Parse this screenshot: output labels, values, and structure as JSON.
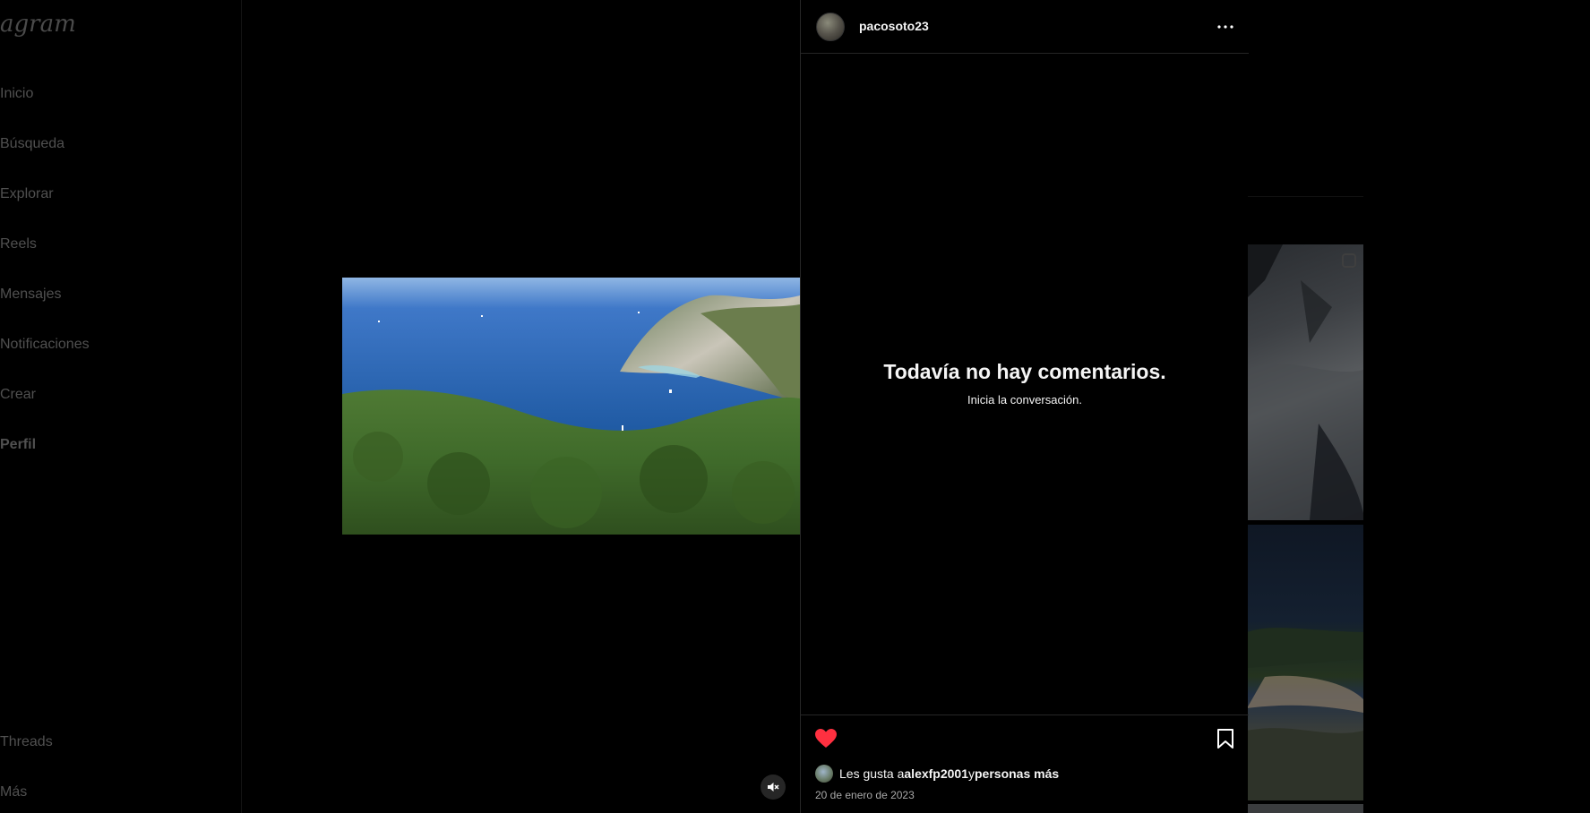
{
  "sidebar": {
    "logo": "agram",
    "items": [
      {
        "label": "Inicio"
      },
      {
        "label": "Búsqueda"
      },
      {
        "label": "Explorar"
      },
      {
        "label": "Reels"
      },
      {
        "label": "Mensajes"
      },
      {
        "label": "Notificaciones"
      },
      {
        "label": "Crear"
      },
      {
        "label": "Perfil"
      }
    ],
    "bottom": [
      {
        "label": "Threads"
      },
      {
        "label": "Más"
      }
    ]
  },
  "post": {
    "username": "pacosoto23",
    "more_icon": "more-horizontal-icon",
    "empty_title": "Todavía no hay comentarios.",
    "empty_subtitle": "Inicia la conversación.",
    "liked": true,
    "like_color": "#ff3040",
    "likes_prefix": "Les gusta a ",
    "likes_user": "alexfp2001",
    "likes_connector": " y ",
    "likes_others": "personas más",
    "date": "20 de enero de 2023"
  },
  "media": {
    "muted": true,
    "mute_icon": "speaker-muted-icon"
  }
}
